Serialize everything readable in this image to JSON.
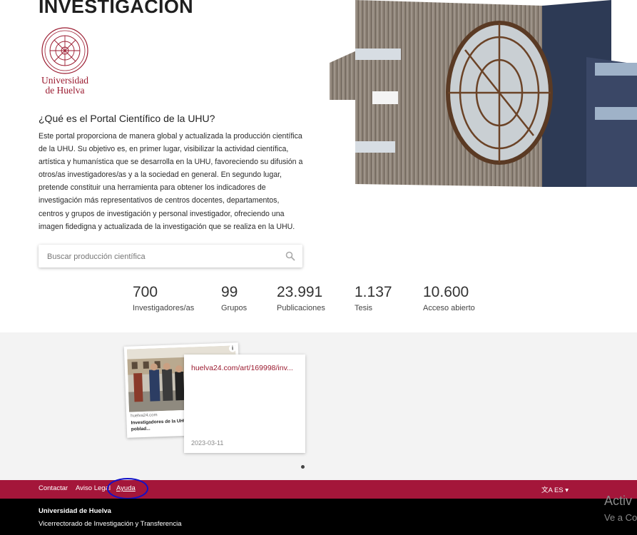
{
  "header": {
    "title": "INVESTIGACIÓN"
  },
  "logo": {
    "name": "university-seal-logo",
    "line1": "Universidad",
    "line2": "de Huelva"
  },
  "intro": {
    "question": "¿Qué es el Portal Científico de la UHU?",
    "paragraph": "Este portal proporciona de manera global y actualizada la producción científica de la UHU. Su objetivo es, en primer lugar, visibilizar la actividad científica, artística y humanística que se desarrolla en la UHU, favoreciendo su difusión a otros/as investigadores/as y a la sociedad en general. En segundo lugar, pretende constituir una herramienta para obtener los indicadores de investigación más representativos de centros docentes, departamentos, centros y grupos de investigación y personal investigador, ofreciendo una imagen fidedigna y actualizada de la investigación que se realiza en la UHU."
  },
  "search": {
    "placeholder": "Buscar producción científica",
    "icon": "search-icon"
  },
  "stats": [
    {
      "value": "700",
      "label": "Investigadores/as"
    },
    {
      "value": "99",
      "label": "Grupos"
    },
    {
      "value": "23.991",
      "label": "Publicaciones"
    },
    {
      "value": "1.137",
      "label": "Tesis"
    },
    {
      "value": "10.600",
      "label": "Acceso abierto"
    }
  ],
  "news": {
    "thumb_source": "huelva24.com",
    "thumb_caption": "Investigadores de la UHU... para revitalizar el poblad...",
    "link": "huelva24.com/art/169998/inv...",
    "date": "2023-03-11"
  },
  "footer_bar": {
    "links": [
      "Contactar",
      "Aviso Legal",
      "Ayuda"
    ],
    "language": "ES",
    "language_icon": "translate-icon"
  },
  "footer": {
    "lines": [
      "Universidad de Huelva",
      "Vicerrectorado de Investigación y Transferencia"
    ]
  },
  "windows_watermark": {
    "line1": "Activ",
    "line2": "Ve a Co"
  },
  "colors": {
    "brand": "#a4163a",
    "footer": "#000000",
    "annotation": "#1010c8"
  }
}
